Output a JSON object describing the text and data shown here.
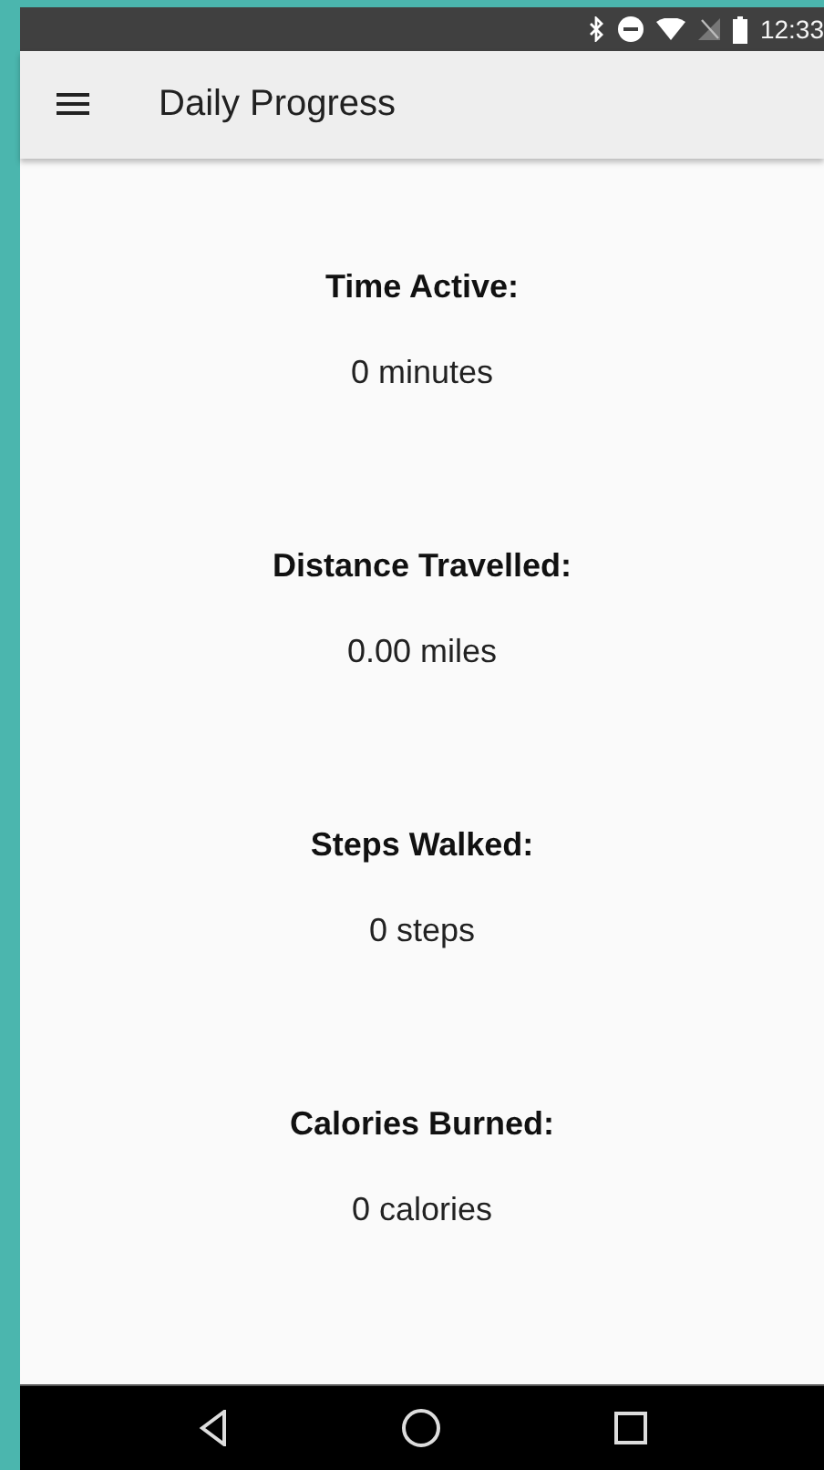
{
  "status_bar": {
    "time": "12:33"
  },
  "app_bar": {
    "title": "Daily Progress"
  },
  "stats": [
    {
      "label": "Time Active:",
      "value": "0 minutes"
    },
    {
      "label": "Distance Travelled:",
      "value": "0.00 miles"
    },
    {
      "label": "Steps Walked:",
      "value": "0 steps"
    },
    {
      "label": "Calories Burned:",
      "value": "0 calories"
    }
  ]
}
